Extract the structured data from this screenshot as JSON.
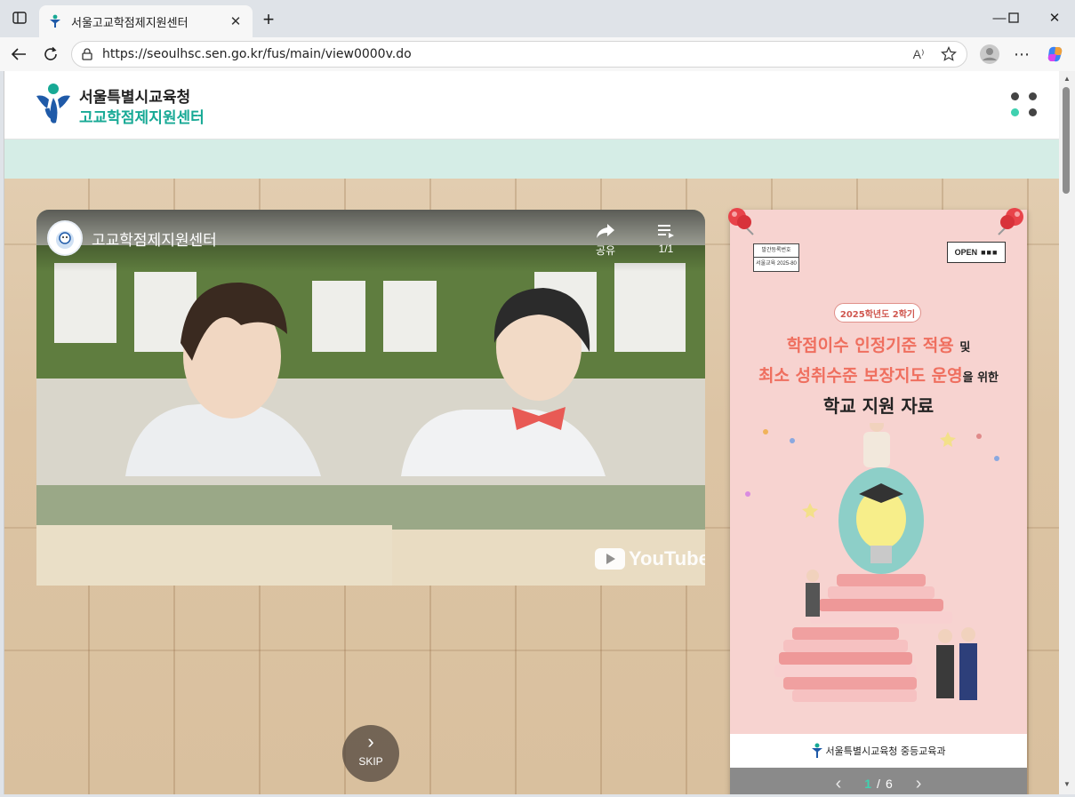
{
  "browser": {
    "tab_title": "서울고교학점제지원센터",
    "url": "https://seoulhsc.sen.go.kr/fus/main/view0000v.do",
    "read_aloud_label": "A⁾"
  },
  "site": {
    "org_name": "서울특별시교육청",
    "center_name": "고교학점제지원센터"
  },
  "video": {
    "channel_name": "고교학점제지원센터",
    "share_label": "공유",
    "playlist_count": "1/1",
    "youtube_label": "YouTube"
  },
  "poster": {
    "pub_label": "발간등록번호",
    "pub_number": "서울교육 2025-80",
    "open_label": "OPEN",
    "semester": "2025학년도 2학기",
    "title_line1_a": "학점이수 인정기준 적용",
    "title_line1_b": "및",
    "title_line2_a": "최소 성취수준 보장지도 운영",
    "title_line2_b": "을 위한",
    "title_line3": "학교 지원 자료",
    "footer": "서울특별시교육청 중등교육과",
    "current_page": "1",
    "separator": "/",
    "total_pages": "6"
  },
  "skip_label": "SKIP",
  "colors": {
    "brand_teal": "#17a995",
    "mint_band": "#d5ede6",
    "poster_pink": "#f7d3d0",
    "title_coral": "#ef6f5f"
  }
}
